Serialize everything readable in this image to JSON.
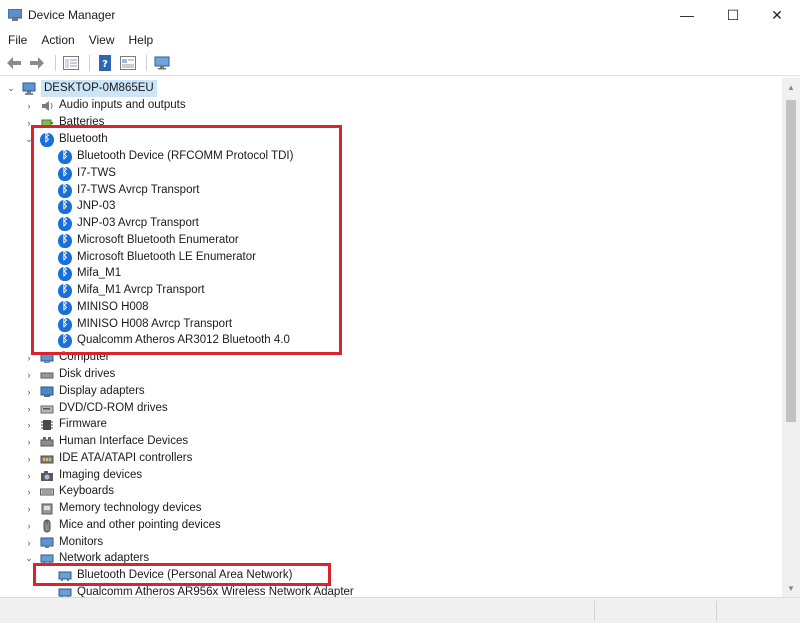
{
  "window": {
    "title": "Device Manager",
    "minimize_icon": "—",
    "maximize_icon": "☐",
    "close_icon": "✕"
  },
  "menu": [
    "File",
    "Action",
    "View",
    "Help"
  ],
  "tree": {
    "root": "DESKTOP-0M865EU",
    "categories": {
      "audio": "Audio inputs and outputs",
      "batteries": "Batteries",
      "bluetooth": "Bluetooth",
      "computer": "Computer",
      "disk": "Disk drives",
      "display": "Display adapters",
      "dvd": "DVD/CD-ROM drives",
      "firmware": "Firmware",
      "hid": "Human Interface Devices",
      "ide": "IDE ATA/ATAPI controllers",
      "imaging": "Imaging devices",
      "keyboards": "Keyboards",
      "memory": "Memory technology devices",
      "mice": "Mice and other pointing devices",
      "monitors": "Monitors",
      "network": "Network adapters"
    },
    "bluetooth_devices": [
      "Bluetooth Device (RFCOMM Protocol TDI)",
      "I7-TWS",
      "I7-TWS Avrcp Transport",
      "JNP-03",
      "JNP-03 Avrcp Transport",
      "Microsoft Bluetooth Enumerator",
      "Microsoft Bluetooth LE Enumerator",
      "Mifa_M1",
      "Mifa_M1 Avrcp Transport",
      "MINISO H008",
      "MINISO H008 Avrcp Transport",
      "Qualcomm Atheros AR3012 Bluetooth 4.0"
    ],
    "network_devices": [
      "Bluetooth Device (Personal Area Network)",
      "Qualcomm Atheros AR956x Wireless Network Adapter"
    ]
  },
  "colors": {
    "highlight_box": "#d9232e",
    "bluetooth_icon": "#1a6fd8"
  }
}
